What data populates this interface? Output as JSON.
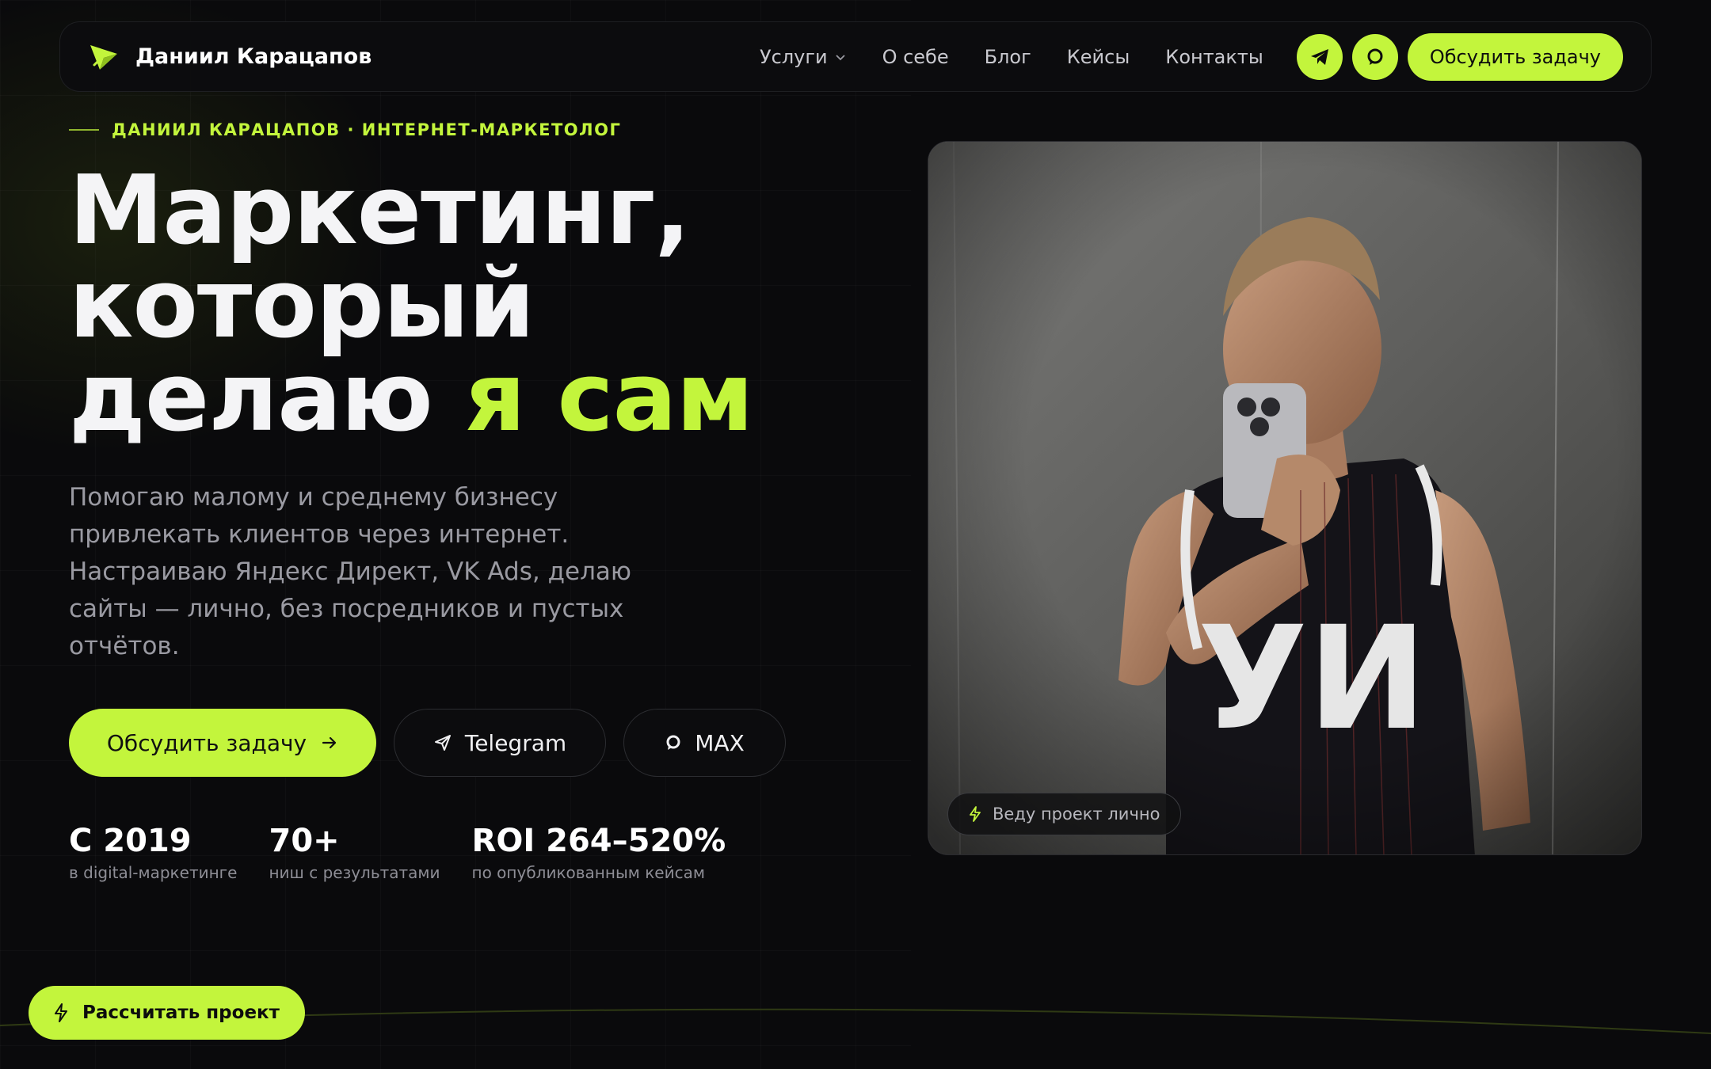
{
  "nav": {
    "brand": "Даниил Карацапов",
    "links": [
      "Услуги",
      "О себе",
      "Блог",
      "Кейсы",
      "Контакты"
    ],
    "cta": "Обсудить задачу"
  },
  "hero": {
    "eyebrow": "ДАНИИЛ КАРАЦАПОВ · ИНТЕРНЕТ-МАРКЕТОЛОГ",
    "headline_line1": "Маркетинг,",
    "headline_line2": "который",
    "headline_line3a": "делаю ",
    "headline_line3b": "я сам",
    "lead": "Помогаю малому и среднему бизнесу привлекать клиентов через интернет. Настраиваю Яндекс Директ, VK Ads, делаю сайты — лично, без посредников и пустых отчётов.",
    "btn_primary": "Обсудить задачу",
    "btn_telegram": "Telegram",
    "btn_max": "MAX",
    "stats": [
      {
        "value": "С 2019",
        "label": "в digital-маркетинге"
      },
      {
        "value": "70+",
        "label": "ниш с результатами"
      },
      {
        "value": "ROI 264–520%",
        "label": "по опубликованным кейсам"
      }
    ],
    "photo_badge": "Веду проект лично"
  },
  "floating": {
    "label": "Рассчитать проект"
  },
  "colors": {
    "accent": "#c3f53c",
    "background": "#0a0a0c"
  }
}
